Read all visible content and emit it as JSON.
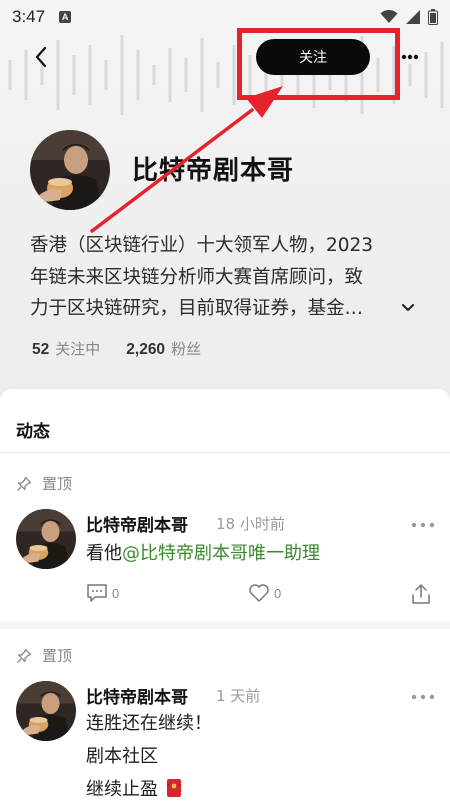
{
  "status_bar": {
    "time": "3:47",
    "notification_icon": "A"
  },
  "nav": {
    "follow_label": "关注",
    "icons": [
      "back-icon",
      "more-icon"
    ]
  },
  "profile": {
    "name": "比特帝剧本哥",
    "bio_lines": [
      "香港（区块链行业）十大领军人物，2023",
      "年链未来区块链分析师大赛首席顾问，致",
      "力于区块链研究，目前取得证券，基金…"
    ],
    "following_count": "52",
    "following_label": "关注中",
    "followers_count": "2,260",
    "followers_label": "粉丝"
  },
  "feed": {
    "title": "动态",
    "posts": [
      {
        "pinned_label": "置顶",
        "author": "比特帝剧本哥",
        "time": "18 小时前",
        "text_prefix": "看他",
        "mention": "@比特帝剧本哥唯一助理",
        "comment_count": "0",
        "like_count": "0"
      },
      {
        "pinned_label": "置顶",
        "author": "比特帝剧本哥",
        "time": "1 天前",
        "lines": [
          "连胜还在继续！",
          "剧本社区",
          "继续止盈"
        ]
      }
    ]
  },
  "colors": {
    "annotation": "#e5232b",
    "mention": "#3b8a2e",
    "follow_button": "#0a0a0a"
  }
}
